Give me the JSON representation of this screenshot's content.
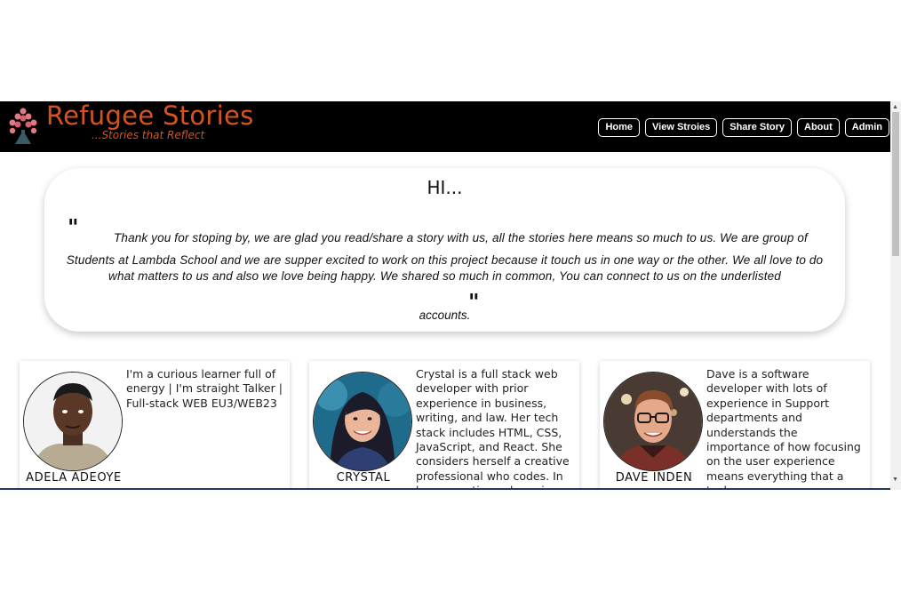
{
  "brand": {
    "title": "Refugee Stories",
    "tagline": "...Stories that Reflect",
    "accent_color": "#d6531e"
  },
  "nav": {
    "items": [
      "Home",
      "View Stroies",
      "Share Story",
      "About",
      "Admin"
    ]
  },
  "intro": {
    "title": "HI...",
    "quote_open": "\"",
    "quote_close": "\"",
    "text_line1": "Thank you for stoping by, we are glad you read/share a story with us, all the stories here means so much to us. We are group of",
    "text_rest": "Students at Lambda School and we are supper excited to work on this project because it touch us in one way or the other. We all love to do what matters to us and also we love being happy. We shared so much in common, You can connect to us on the underlisted",
    "text_end": "accounts."
  },
  "members": [
    {
      "name": "ADELA ADEOYE",
      "bio": "I'm a curious learner full of energy | I'm straight Talker | Full-stack WEB EU3/WEB23",
      "avatar_icon": "person-portrait-icon"
    },
    {
      "name": "CRYSTAL",
      "bio": "Crystal is a full stack web developer with prior experience in business, writing, and law. Her tech stack includes HTML, CSS, JavaScript, and React. She considers herself a creative professional who codes. In her spare time, she enjoys",
      "avatar_icon": "person-portrait-icon"
    },
    {
      "name": "DAVE INDEN",
      "bio": "Dave is a software developer with lots of experience in Support departments and understands the importance of how focusing on the user experience means everything that a tech",
      "avatar_icon": "person-portrait-icon"
    }
  ],
  "icons": {
    "logo": "tree-logo-icon",
    "scroll_up": "arrow-up-icon",
    "scroll_down": "arrow-down-icon"
  }
}
